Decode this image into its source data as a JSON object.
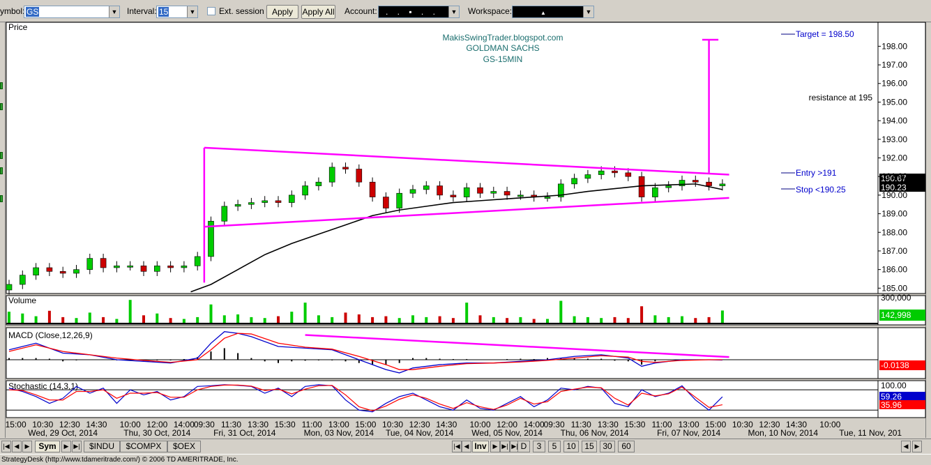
{
  "toolbar": {
    "symbol_label": "ymbol:",
    "symbol_value": "GS",
    "interval_label": "Interval:",
    "interval_value": "15",
    "ext_session_label": "Ext. session",
    "apply_label": "Apply",
    "apply_all_label": "Apply All",
    "account_label": "Account:",
    "account_value": ". . ▪ . .",
    "workspace_label": "Workspace:",
    "workspace_value": "▲"
  },
  "price_panel": {
    "label": "Price",
    "watermark": [
      "MakisSwingTrader.blogspot.com",
      "GOLDMAN SACHS",
      "GS-15MIN"
    ],
    "target_label": "Target = 198.50",
    "entry_label": "Entry >191",
    "stop_label": "Stop <190.25",
    "resistance_label": "resistance at 195",
    "last_price": "190.67",
    "ma_price": "190.23"
  },
  "volume_panel": {
    "label": "Volume",
    "top_tick": "300,000",
    "last_value": "142,998"
  },
  "macd_panel": {
    "label": "MACD (Close,12,26,9)",
    "last_value": "-0.0138"
  },
  "stoch_panel": {
    "label": "Stochastic (14,3,1)",
    "top_tick": "100.00",
    "k_value": "59.26",
    "d_value": "35.96"
  },
  "tabs": {
    "left": [
      "Sym",
      "$INDU",
      "$COMPX",
      "$OEX"
    ],
    "inv": "Inv",
    "intervals": [
      "D",
      "3",
      "5",
      "10",
      "15",
      "30",
      "60"
    ]
  },
  "status": "StrategyDesk (http://www.tdameritrade.com/) © 2006 TD AMERITRADE, Inc.",
  "colors": {
    "bull": "#00cc00",
    "bear": "#cc0000",
    "pattern": "#ff00ff",
    "ma": "#000000",
    "blue": "#0000cc",
    "red": "#ff0000"
  },
  "chart_data": [
    {
      "type": "candlestick",
      "title": "GOLDMAN SACHS GS-15MIN",
      "ylabel": "Price",
      "ylim": [
        184.75,
        199.25
      ],
      "y_ticks": [
        185,
        186,
        187,
        188,
        189,
        190,
        191,
        192,
        193,
        194,
        195,
        196,
        197,
        198
      ],
      "x_ticks": [
        {
          "label": "15:00",
          "x": 0.5
        },
        {
          "label": "10:30",
          "x": 2.5
        },
        {
          "label": "12:30",
          "x": 4.5
        },
        {
          "label": "14:30",
          "x": 6.5
        },
        {
          "label": "10:00",
          "x": 9
        },
        {
          "label": "12:00",
          "x": 11
        },
        {
          "label": "14:00",
          "x": 13
        },
        {
          "label": "09:30",
          "x": 14.5
        },
        {
          "label": "11:30",
          "x": 16.5
        },
        {
          "label": "13:30",
          "x": 18.5
        },
        {
          "label": "15:30",
          "x": 20.5
        },
        {
          "label": "11:00",
          "x": 22.5
        },
        {
          "label": "13:00",
          "x": 24.5
        },
        {
          "label": "15:00",
          "x": 26.5
        },
        {
          "label": "10:30",
          "x": 28.5
        },
        {
          "label": "12:30",
          "x": 30.5
        },
        {
          "label": "14:30",
          "x": 32.5
        },
        {
          "label": "10:00",
          "x": 35
        },
        {
          "label": "12:00",
          "x": 37
        },
        {
          "label": "14:00",
          "x": 39
        },
        {
          "label": "09:30",
          "x": 40.5
        },
        {
          "label": "11:30",
          "x": 42.5
        },
        {
          "label": "13:30",
          "x": 44.5
        },
        {
          "label": "15:30",
          "x": 46.5
        },
        {
          "label": "11:00",
          "x": 48.5
        },
        {
          "label": "13:00",
          "x": 50.5
        },
        {
          "label": "15:00",
          "x": 52.5
        },
        {
          "label": "10:30",
          "x": 54.5
        },
        {
          "label": "12:30",
          "x": 56.5
        },
        {
          "label": "14:30",
          "x": 58.5
        },
        {
          "label": "10:00",
          "x": 61
        }
      ],
      "date_labels": [
        {
          "label": "Wed, 29 Oct, 2014",
          "x": 4
        },
        {
          "label": "Thu, 30 Oct, 2014",
          "x": 11
        },
        {
          "label": "Fri, 31 Oct, 2014",
          "x": 17.5
        },
        {
          "label": "Mon, 03 Nov, 2014",
          "x": 24.5
        },
        {
          "label": "Tue, 04 Nov, 2014",
          "x": 30.5
        },
        {
          "label": "Wed, 05 Nov, 2014",
          "x": 37
        },
        {
          "label": "Thu, 06 Nov, 2014",
          "x": 43.5
        },
        {
          "label": "Fri, 07 Nov, 2014",
          "x": 50.5
        },
        {
          "label": "Mon, 10 Nov, 2014",
          "x": 57.5
        },
        {
          "label": "Tue, 11 Nov, 201",
          "x": 64
        }
      ],
      "x_range": [
        0,
        64.6
      ],
      "series": [
        {
          "name": "close",
          "x": [
            0,
            1,
            2,
            3,
            4,
            5,
            6,
            7,
            8,
            9,
            10,
            11,
            12,
            13,
            14,
            15,
            16,
            17,
            18,
            19,
            20,
            21,
            22,
            23,
            24,
            25,
            26,
            27,
            28,
            29,
            30,
            31,
            32,
            33,
            34,
            35,
            36,
            37,
            38,
            39,
            40,
            41,
            42,
            43,
            44,
            45,
            46,
            47,
            48,
            49,
            50,
            51,
            52,
            53
          ],
          "values": [
            185.2,
            185.7,
            186.1,
            185.9,
            185.8,
            186.0,
            186.6,
            186.1,
            186.2,
            186.2,
            185.9,
            186.2,
            186.1,
            186.2,
            186.7,
            188.6,
            189.4,
            189.5,
            189.6,
            189.7,
            189.6,
            190.0,
            190.5,
            190.7,
            191.5,
            191.4,
            190.7,
            189.9,
            189.3,
            190.1,
            190.3,
            190.5,
            190.0,
            189.9,
            190.4,
            190.1,
            190.2,
            190.0,
            190.0,
            189.9,
            189.9,
            190.6,
            190.9,
            191.1,
            191.3,
            191.2,
            191.0,
            189.9,
            190.4,
            190.5,
            190.8,
            190.7,
            190.5,
            190.6
          ]
        },
        {
          "name": "MA",
          "x": [
            13.5,
            15,
            17,
            19,
            21,
            23,
            25,
            27,
            29,
            31,
            33,
            35,
            37,
            39,
            41,
            43,
            45,
            47,
            49,
            51,
            53
          ],
          "values": [
            184.8,
            185.2,
            186.0,
            186.8,
            187.4,
            187.9,
            188.4,
            188.9,
            189.2,
            189.4,
            189.6,
            189.7,
            189.8,
            189.9,
            190.0,
            190.2,
            190.35,
            190.5,
            190.55,
            190.6,
            190.3
          ]
        }
      ],
      "pattern_lines": [
        {
          "x": [
            14.5,
            53.5
          ],
          "values": [
            192.55,
            191.1
          ]
        },
        {
          "x": [
            14.5,
            53.5
          ],
          "values": [
            188.3,
            189.85
          ]
        },
        {
          "x": [
            14.5,
            14.5
          ],
          "values": [
            185.3,
            192.55
          ]
        },
        {
          "x": [
            52,
            52,
            51.5,
            52.7
          ],
          "values": [
            191.2,
            198.35,
            198.35,
            198.35
          ]
        }
      ],
      "annotations": [
        {
          "text": "Target = 198.50",
          "value": 198.5
        },
        {
          "text": "Entry >191",
          "value": 191
        },
        {
          "text": "Stop <190.25",
          "value": 190.25
        },
        {
          "text": "resistance at 195",
          "value": 195
        }
      ]
    },
    {
      "type": "bar",
      "ylabel": "Volume",
      "ylim": [
        0,
        300000
      ],
      "x": [
        0,
        1,
        2,
        3,
        4,
        5,
        6,
        7,
        8,
        9,
        10,
        11,
        12,
        13,
        14,
        15,
        16,
        17,
        18,
        19,
        20,
        21,
        22,
        23,
        24,
        25,
        26,
        27,
        28,
        29,
        30,
        31,
        32,
        33,
        34,
        35,
        36,
        37,
        38,
        39,
        40,
        41,
        42,
        43,
        44,
        45,
        46,
        47,
        48,
        49,
        50,
        51,
        52,
        53
      ],
      "values": [
        130000,
        110000,
        80000,
        140000,
        70000,
        60000,
        120000,
        70000,
        50000,
        260000,
        90000,
        110000,
        60000,
        50000,
        70000,
        210000,
        90000,
        100000,
        70000,
        60000,
        80000,
        130000,
        230000,
        90000,
        70000,
        120000,
        100000,
        70000,
        80000,
        60000,
        90000,
        70000,
        80000,
        60000,
        230000,
        90000,
        70000,
        60000,
        70000,
        50000,
        50000,
        250000,
        80000,
        70000,
        60000,
        70000,
        60000,
        190000,
        90000,
        70000,
        80000,
        60000,
        70000,
        142998
      ]
    },
    {
      "type": "line",
      "ylabel": "MACD (Close,12,26,9)",
      "ylim": [
        -0.55,
        0.95
      ],
      "series": [
        {
          "name": "MACD",
          "x": [
            0,
            2,
            4,
            6,
            8,
            10,
            12,
            14,
            15,
            16,
            17,
            18,
            20,
            22,
            24,
            26,
            28,
            29,
            30,
            32,
            34,
            36,
            38,
            40,
            42,
            44,
            46,
            47,
            48,
            50,
            52,
            53
          ],
          "values": [
            0.3,
            0.5,
            0.2,
            0.15,
            0.0,
            -0.05,
            -0.1,
            0.05,
            0.5,
            0.85,
            0.8,
            0.7,
            0.4,
            0.35,
            0.3,
            0.0,
            -0.3,
            -0.4,
            -0.25,
            -0.15,
            -0.1,
            -0.1,
            -0.05,
            0.0,
            0.1,
            0.15,
            0.05,
            -0.2,
            -0.1,
            0.0,
            0.0,
            -0.01
          ]
        },
        {
          "name": "Signal",
          "x": [
            0,
            2,
            4,
            6,
            8,
            10,
            12,
            14,
            15,
            16,
            17,
            18,
            20,
            22,
            24,
            26,
            28,
            29,
            30,
            32,
            34,
            36,
            38,
            40,
            42,
            44,
            46,
            47,
            48,
            50,
            52,
            53
          ],
          "values": [
            0.25,
            0.45,
            0.25,
            0.15,
            0.05,
            -0.02,
            -0.08,
            0.0,
            0.3,
            0.65,
            0.8,
            0.78,
            0.5,
            0.38,
            0.32,
            0.1,
            -0.15,
            -0.3,
            -0.3,
            -0.2,
            -0.12,
            -0.1,
            -0.07,
            -0.02,
            0.05,
            0.12,
            0.08,
            -0.05,
            -0.08,
            -0.02,
            0.0,
            0.0
          ]
        },
        {
          "name": "Histogram",
          "x": [
            0,
            1,
            2,
            3,
            4,
            5,
            6,
            7,
            8,
            9,
            10,
            11,
            12,
            13,
            14,
            15,
            16,
            17,
            18,
            19,
            20,
            21,
            22,
            23,
            24,
            25,
            26,
            27,
            28,
            29,
            30,
            31,
            32,
            33,
            34,
            35,
            36,
            37,
            38,
            39,
            40,
            41,
            42,
            43,
            44,
            45,
            46,
            47,
            48,
            49,
            50,
            51,
            52,
            53
          ],
          "values": [
            0.05,
            0.05,
            0.05,
            0.03,
            -0.05,
            -0.02,
            -0.01,
            0.0,
            -0.02,
            -0.03,
            -0.03,
            -0.02,
            -0.02,
            0.02,
            0.08,
            0.25,
            0.35,
            0.2,
            0.05,
            -0.05,
            -0.1,
            -0.05,
            -0.03,
            -0.02,
            -0.02,
            -0.05,
            -0.1,
            -0.15,
            -0.15,
            -0.1,
            0.05,
            0.05,
            0.03,
            0.02,
            0.02,
            0.0,
            0.0,
            0.02,
            0.03,
            0.02,
            0.05,
            0.05,
            0.05,
            0.03,
            0.03,
            -0.03,
            -0.05,
            -0.15,
            -0.05,
            0.0,
            0.0,
            0.0,
            0.0,
            -0.01
          ]
        }
      ],
      "pattern_lines": [
        {
          "x": [
            22,
            53.5
          ],
          "values": [
            0.75,
            0.08
          ]
        }
      ]
    },
    {
      "type": "line",
      "ylabel": "Stochastic (14,3,1)",
      "ylim": [
        0,
        105
      ],
      "y_ticks": [
        100
      ],
      "reference_lines": [
        80,
        20
      ],
      "series": [
        {
          "name": "%K",
          "x": [
            0,
            1,
            2,
            3,
            4,
            5,
            6,
            7,
            8,
            9,
            10,
            11,
            12,
            13,
            14,
            15,
            16,
            17,
            18,
            19,
            20,
            21,
            22,
            23,
            24,
            25,
            26,
            27,
            28,
            29,
            30,
            31,
            32,
            33,
            34,
            35,
            36,
            37,
            38,
            39,
            40,
            41,
            42,
            43,
            44,
            45,
            46,
            47,
            48,
            49,
            50,
            51,
            52,
            53
          ],
          "values": [
            85,
            75,
            60,
            40,
            55,
            90,
            70,
            85,
            40,
            80,
            65,
            75,
            50,
            60,
            90,
            92,
            95,
            93,
            90,
            70,
            85,
            60,
            90,
            95,
            92,
            50,
            20,
            15,
            40,
            60,
            70,
            50,
            30,
            20,
            50,
            25,
            20,
            40,
            60,
            30,
            50,
            85,
            80,
            90,
            85,
            40,
            30,
            80,
            60,
            70,
            92,
            50,
            20,
            59.26
          ]
        },
        {
          "name": "%D",
          "x": [
            0,
            1,
            2,
            3,
            4,
            5,
            6,
            7,
            8,
            9,
            10,
            11,
            12,
            13,
            14,
            15,
            16,
            17,
            18,
            19,
            20,
            21,
            22,
            23,
            24,
            25,
            26,
            27,
            28,
            29,
            30,
            31,
            32,
            33,
            34,
            35,
            36,
            37,
            38,
            39,
            40,
            41,
            42,
            43,
            44,
            45,
            46,
            47,
            48,
            49,
            50,
            51,
            52,
            53
          ],
          "values": [
            80,
            78,
            65,
            50,
            50,
            75,
            75,
            80,
            55,
            70,
            70,
            72,
            58,
            58,
            80,
            90,
            94,
            94,
            91,
            78,
            82,
            68,
            82,
            92,
            93,
            65,
            30,
            18,
            32,
            52,
            65,
            55,
            38,
            25,
            42,
            30,
            22,
            35,
            55,
            38,
            45,
            75,
            82,
            88,
            86,
            55,
            35,
            70,
            62,
            68,
            88,
            58,
            28,
            35.96
          ]
        }
      ]
    }
  ]
}
